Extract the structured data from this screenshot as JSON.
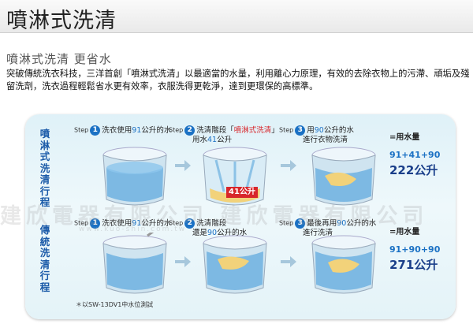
{
  "header": {
    "title": "噴淋式洗清"
  },
  "subtitle": "噴淋式洗清 更省水",
  "intro": "突破傳統洗衣科技，三洋首創「噴淋式洗清」以最適當的水量，利用離心力原理，有效的去除衣物上的污滯、頑垢及殘留洗劑，洗衣過程輕鬆省水更有效率，衣服洗得更乾淨，達到更環保的高標準。",
  "rows": [
    {
      "label": "噴淋式洗清行程",
      "steps": [
        {
          "step": "Step",
          "num": "1",
          "line1_pre": "洗衣使用",
          "line1_hl": "91",
          "line1_post": "公升的水",
          "line2_pre": "",
          "line2_hl": "",
          "line2_post": ""
        },
        {
          "step": "Step",
          "num": "2",
          "line1_pre": "洗清階段「",
          "line1_hl": "噴淋式洗清",
          "line1_post": "」",
          "line2_pre": "用水",
          "line2_hl": "41",
          "line2_post": "公升"
        },
        {
          "step": "Step",
          "num": "3",
          "line1_pre": "用",
          "line1_hl": "90",
          "line1_post": "公升的水",
          "line2_pre": "進行衣物洗清",
          "line2_hl": "",
          "line2_post": ""
        }
      ],
      "badge": "41公升",
      "total_label": "=用水量",
      "total_eq": "91+41+90",
      "total_value": "222",
      "total_unit": "公升"
    },
    {
      "label": "傳統洗清行程",
      "steps": [
        {
          "step": "Step",
          "num": "1",
          "line1_pre": "洗衣使用",
          "line1_hl": "91",
          "line1_post": "公升的水",
          "line2_pre": "",
          "line2_hl": "",
          "line2_post": ""
        },
        {
          "step": "Step",
          "num": "2",
          "line1_pre": "洗清階段",
          "line1_hl": "",
          "line1_post": "",
          "line2_pre": "還是",
          "line2_hl": "90",
          "line2_post": "公升的水"
        },
        {
          "step": "Step",
          "num": "3",
          "line1_pre": "最後再用",
          "line1_hl": "90",
          "line1_post": "公升的水",
          "line2_pre": "進行洗清",
          "line2_hl": "",
          "line2_post": ""
        }
      ],
      "total_label": "=用水量",
      "total_eq": "91+90+90",
      "total_value": "271",
      "total_unit": "公升"
    }
  ],
  "note": "＊以SW-13DV1中水位測試",
  "watermark": "建欣電器有限公司 建欣電器有限公司",
  "watermark_url": "www.kuo-shin.com.tw",
  "colors": {
    "accent": "#1b71c4",
    "highlight_red": "#d8262b",
    "panel": "#e4f3f8"
  },
  "icons": [
    "washing-tub-icon",
    "arrow-right-icon"
  ]
}
